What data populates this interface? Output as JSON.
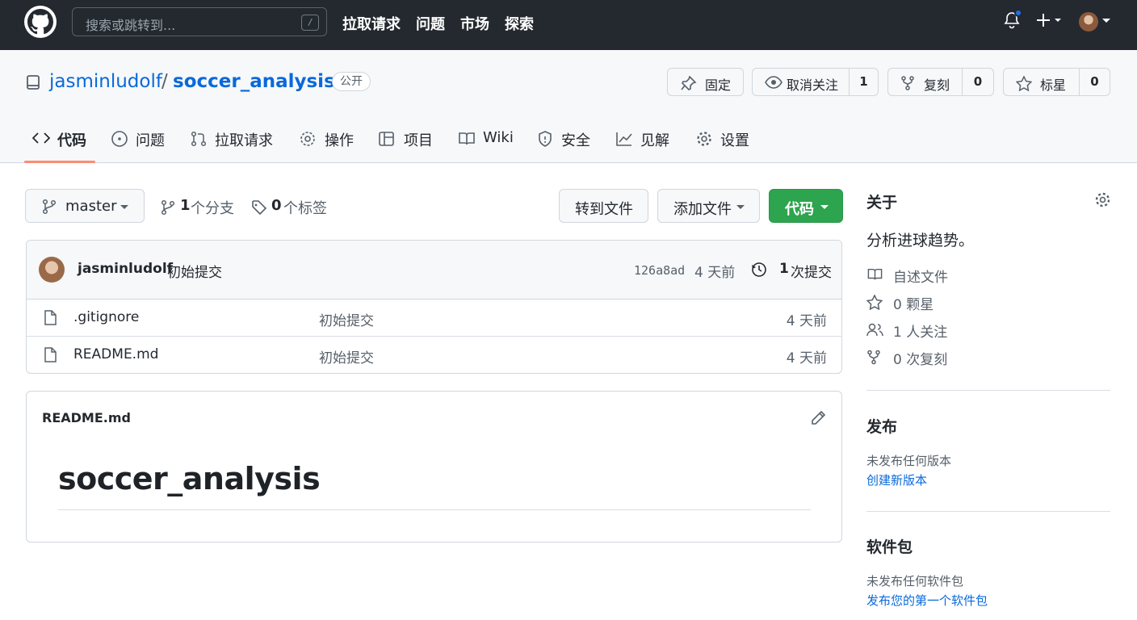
{
  "global_nav": {
    "search_placeholder": "搜索或跳转到...",
    "search_shortcut": "/",
    "links": [
      "拉取请求",
      "问题",
      "市场",
      "探索"
    ]
  },
  "repo": {
    "owner": "jasminludolf",
    "separator": "/",
    "name": "soccer_analysis",
    "visibility": "公开",
    "pin_label": "固定",
    "watch_label": "取消关注",
    "watch_count": "1",
    "fork_label": "复刻",
    "fork_count": "0",
    "star_label": "标星",
    "star_count": "0"
  },
  "tabs": [
    {
      "label": "代码",
      "icon": "code-icon"
    },
    {
      "label": "问题",
      "icon": "issue-icon"
    },
    {
      "label": "拉取请求",
      "icon": "pull-request-icon"
    },
    {
      "label": "操作",
      "icon": "play-icon"
    },
    {
      "label": "项目",
      "icon": "project-icon"
    },
    {
      "label": "Wiki",
      "icon": "book-icon"
    },
    {
      "label": "安全",
      "icon": "shield-icon"
    },
    {
      "label": "见解",
      "icon": "graph-icon"
    },
    {
      "label": "设置",
      "icon": "gear-icon"
    }
  ],
  "toolbar": {
    "branch": "master",
    "branches_count": "1",
    "branches_label": "个分支",
    "tags_count": "0",
    "tags_label": "个标签",
    "goto_file": "转到文件",
    "add_file": "添加文件",
    "code_button": "代码"
  },
  "latest_commit": {
    "author": "jasminludolf",
    "message": "初始提交",
    "sha": "126a8ad",
    "age": "4 天前",
    "commits_count": "1",
    "commits_label": "次提交"
  },
  "files": [
    {
      "name": ".gitignore",
      "message": "初始提交",
      "age": "4 天前"
    },
    {
      "name": "README.md",
      "message": "初始提交",
      "age": "4 天前"
    }
  ],
  "readme": {
    "filename": "README.md",
    "heading": "soccer_analysis"
  },
  "sidebar": {
    "about_title": "关于",
    "description": "分析进球趋势。",
    "items": [
      {
        "label": "自述文件",
        "icon": "book-icon"
      },
      {
        "label": "0 颗星",
        "icon": "star-icon"
      },
      {
        "label": "1 人关注",
        "icon": "people-icon"
      },
      {
        "label": "0 次复刻",
        "icon": "fork-icon"
      }
    ],
    "releases_title": "发布",
    "releases_note": "未发布任何版本",
    "releases_link": "创建新版本",
    "packages_title": "软件包",
    "packages_note": "未发布任何软件包",
    "packages_link": "发布您的第一个软件包"
  },
  "colors": {
    "header_bg": "#24292f",
    "link": "#0969da",
    "primary_button": "#2da44e",
    "tab_underline": "#fd8c73",
    "notification_dot": "#1f6feb"
  }
}
